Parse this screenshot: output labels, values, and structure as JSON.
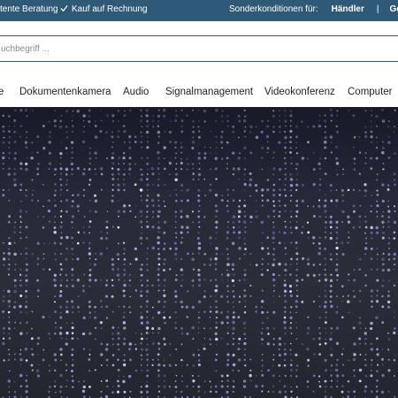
{
  "topbar": {
    "benefit_1": "tente Beratung",
    "benefit_2": "Kauf auf Rechnung",
    "special_label": "Sonderkonditionen für:",
    "link_dealer": "Händler",
    "separator": "|",
    "link_cut": "Ges",
    "check_icon": "check-icon",
    "background": "#2f5a77"
  },
  "search": {
    "placeholder": "uchbegriff ...",
    "value": ""
  },
  "nav": {
    "items": [
      {
        "label": "e"
      },
      {
        "label": "Dokumentenkamera"
      },
      {
        "label": "Audio"
      },
      {
        "label": "Signalmanagement"
      },
      {
        "label": "Videokonferenz"
      },
      {
        "label": "Computer"
      }
    ]
  },
  "hero": {
    "description_color_base": "#23252f",
    "dot_color": "#b9aef0"
  }
}
